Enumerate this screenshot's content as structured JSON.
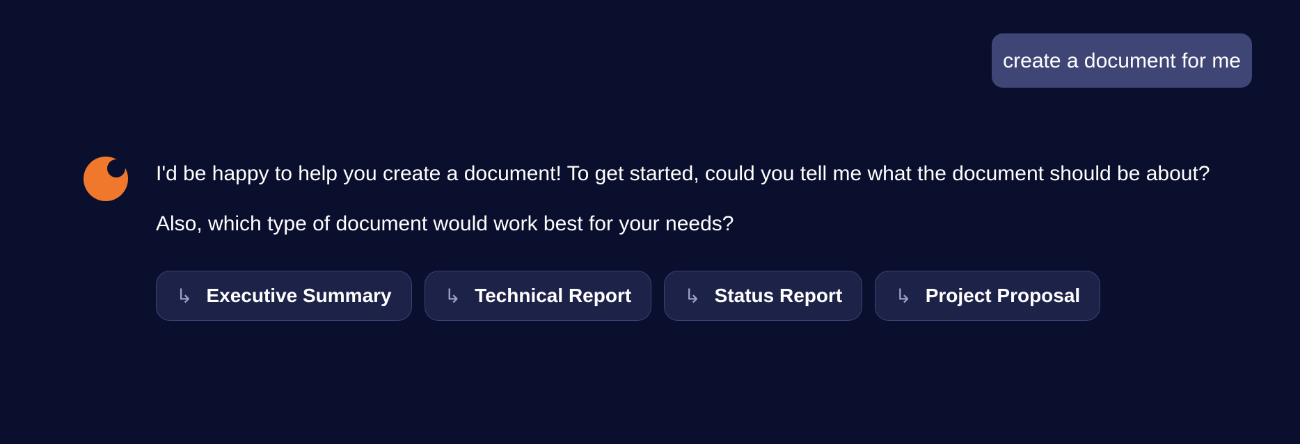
{
  "conversation": {
    "user_message": "create a document for me",
    "assistant": {
      "avatar_icon": "assistant-avatar-icon",
      "paragraphs": [
        "I'd be happy to help you create a document! To get started, could you tell me what the document should be about?",
        "Also, which type of document would work best for your needs?"
      ],
      "options": [
        {
          "label": "Executive Summary",
          "icon": "↳"
        },
        {
          "label": "Technical Report",
          "icon": "↳"
        },
        {
          "label": "Status Report",
          "icon": "↳"
        },
        {
          "label": "Project Proposal",
          "icon": "↳"
        }
      ]
    }
  },
  "colors": {
    "background": "#0b0f2e",
    "user_bubble": "#3f4574",
    "avatar": "#f0782c",
    "option_background": "#1d2248",
    "option_border": "#3c4274",
    "arrow": "#9aa0c8"
  }
}
